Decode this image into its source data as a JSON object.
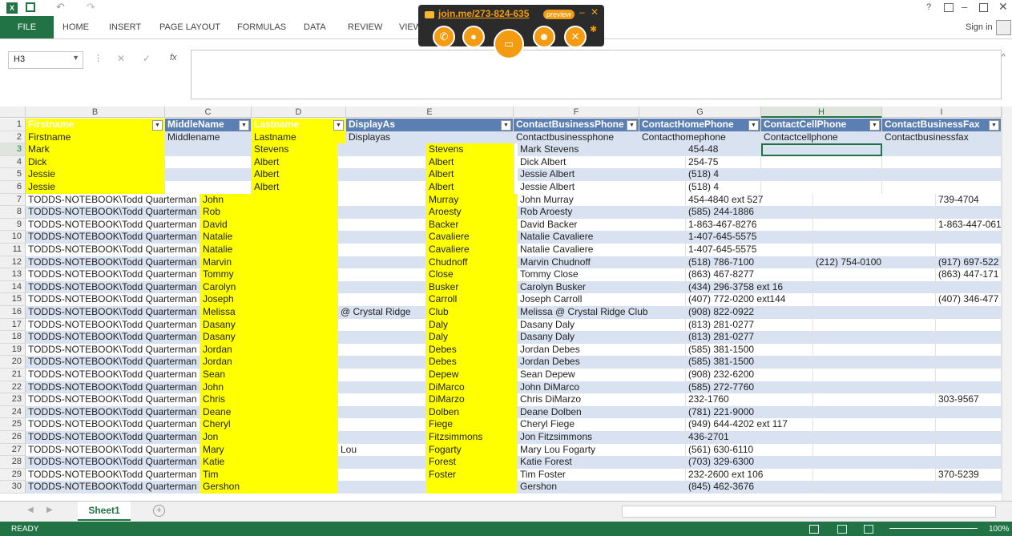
{
  "window": {
    "help": "?",
    "sign_in": "Sign in"
  },
  "ribbon": {
    "tabs": [
      "FILE",
      "HOME",
      "INSERT",
      "PAGE LAYOUT",
      "FORMULAS",
      "DATA",
      "REVIEW",
      "VIEW"
    ]
  },
  "formula_bar": {
    "name_box": "H3",
    "fx": "fx",
    "formula": ""
  },
  "joinme": {
    "url": "join.me/273-824-635",
    "badge": "preview"
  },
  "columns": [
    "B",
    "C",
    "D",
    "E",
    "F",
    "G",
    "H",
    "I"
  ],
  "header_row": [
    "Firstname",
    "MiddleName",
    "Lastname",
    "DisplayAs",
    "ContactBusinessPhone",
    "ContactHomePhone",
    "ContactCellPhone",
    "ContactBusinessFax"
  ],
  "row2": [
    "Firstname",
    "Middlename",
    "Lastname",
    "Displayas",
    "Contactbusinessphone",
    "Contacthomephone",
    "Contactcellphone",
    "Contactbusinessfax"
  ],
  "top_rows": [
    {
      "n": "3",
      "b": "Mark",
      "d": "Stevens",
      "e": "Stevens",
      "f": "Mark Stevens",
      "g": "454-48"
    },
    {
      "n": "4",
      "b": "Dick",
      "d": "Albert",
      "e": "Albert",
      "f": "Dick Albert",
      "g": "254-75"
    },
    {
      "n": "5",
      "b": "Jessie",
      "d": "Albert",
      "e": "Albert",
      "f": "Jessie Albert",
      "g": "(518) 4"
    },
    {
      "n": "6",
      "b": "Jessie",
      "d": "Albert",
      "e": "Albert",
      "f": "Jessie Albert",
      "g": "(518) 4"
    }
  ],
  "rows": [
    {
      "n": "7",
      "a": "TODDS-NOTEBOOK\\Todd Quarterman",
      "b": "John",
      "e": "Murray",
      "f": "John Murray",
      "g": "454-4840 ext 527",
      "h": "",
      "i": "739-4704"
    },
    {
      "n": "8",
      "a": "TODDS-NOTEBOOK\\Todd Quarterman",
      "b": "Rob",
      "e": "Aroesty",
      "f": "Rob Aroesty",
      "g": "(585) 244-1886",
      "h": "",
      "i": ""
    },
    {
      "n": "9",
      "a": "TODDS-NOTEBOOK\\Todd Quarterman",
      "b": "David",
      "e": "Backer",
      "f": "David Backer",
      "g": "1-863-467-8276",
      "h": "",
      "i": "1-863-447-061"
    },
    {
      "n": "10",
      "a": "TODDS-NOTEBOOK\\Todd Quarterman",
      "b": "Natalie",
      "e": "Cavaliere",
      "f": "Natalie Cavaliere",
      "g": "1-407-645-5575",
      "h": "",
      "i": ""
    },
    {
      "n": "11",
      "a": "TODDS-NOTEBOOK\\Todd Quarterman",
      "b": "Natalie",
      "e": "Cavaliere",
      "f": "Natalie Cavaliere",
      "g": "1-407-645-5575",
      "h": "",
      "i": ""
    },
    {
      "n": "12",
      "a": "TODDS-NOTEBOOK\\Todd Quarterman",
      "b": "Marvin",
      "e": "Chudnoff",
      "f": "Marvin Chudnoff",
      "g": "(518) 786-7100",
      "h": "(212) 754-0100",
      "i": "(917) 697-522"
    },
    {
      "n": "13",
      "a": "TODDS-NOTEBOOK\\Todd Quarterman",
      "b": "Tommy",
      "e": "Close",
      "f": "Tommy Close",
      "g": "(863) 467-8277",
      "h": "",
      "i": "(863) 447-171"
    },
    {
      "n": "14",
      "a": "TODDS-NOTEBOOK\\Todd Quarterman",
      "b": "Carolyn",
      "e": "Busker",
      "f": "Carolyn Busker",
      "g": "(434) 296-3758 ext 16",
      "h": "",
      "i": ""
    },
    {
      "n": "15",
      "a": "TODDS-NOTEBOOK\\Todd Quarterman",
      "b": "Joseph",
      "e": "Carroll",
      "f": "Joseph Carroll",
      "g": "(407) 772-0200 ext144",
      "h": "",
      "i": "(407) 346-477"
    },
    {
      "n": "16",
      "a": "TODDS-NOTEBOOK\\Todd Quarterman",
      "b": "Melissa",
      "d2": "@ Crystal Ridge",
      "e": "Club",
      "f": "Melissa @ Crystal Ridge Club",
      "g": "(908) 822-0922",
      "h": "",
      "i": ""
    },
    {
      "n": "17",
      "a": "TODDS-NOTEBOOK\\Todd Quarterman",
      "b": "Dasany",
      "e": "Daly",
      "f": "Dasany Daly",
      "g": "(813) 281-0277",
      "h": "",
      "i": ""
    },
    {
      "n": "18",
      "a": "TODDS-NOTEBOOK\\Todd Quarterman",
      "b": "Dasany",
      "e": "Daly",
      "f": "Dasany Daly",
      "g": "(813) 281-0277",
      "h": "",
      "i": ""
    },
    {
      "n": "19",
      "a": "TODDS-NOTEBOOK\\Todd Quarterman",
      "b": "Jordan",
      "e": "Debes",
      "f": "Jordan Debes",
      "g": "(585) 381-1500",
      "h": "",
      "i": ""
    },
    {
      "n": "20",
      "a": "TODDS-NOTEBOOK\\Todd Quarterman",
      "b": "Jordan",
      "e": "Debes",
      "f": "Jordan Debes",
      "g": "(585) 381-1500",
      "h": "",
      "i": ""
    },
    {
      "n": "21",
      "a": "TODDS-NOTEBOOK\\Todd Quarterman",
      "b": "Sean",
      "e": "Depew",
      "f": "Sean Depew",
      "g": "(908) 232-6200",
      "h": "",
      "i": ""
    },
    {
      "n": "22",
      "a": "TODDS-NOTEBOOK\\Todd Quarterman",
      "b": "John",
      "e": "DiMarco",
      "f": "John DiMarco",
      "g": "(585) 272-7760",
      "h": "",
      "i": ""
    },
    {
      "n": "23",
      "a": "TODDS-NOTEBOOK\\Todd Quarterman",
      "b": "Chris",
      "e": "DiMarzo",
      "f": "Chris DiMarzo",
      "g": "232-1760",
      "h": "",
      "i": "303-9567"
    },
    {
      "n": "24",
      "a": "TODDS-NOTEBOOK\\Todd Quarterman",
      "b": "Deane",
      "e": "Dolben",
      "f": "Deane Dolben",
      "g": "(781) 221-9000",
      "h": "",
      "i": ""
    },
    {
      "n": "25",
      "a": "TODDS-NOTEBOOK\\Todd Quarterman",
      "b": "Cheryl",
      "e": "Fiege",
      "f": "Cheryl Fiege",
      "g": "(949) 644-4202 ext 117",
      "h": "",
      "i": ""
    },
    {
      "n": "26",
      "a": "TODDS-NOTEBOOK\\Todd Quarterman",
      "b": "Jon",
      "e": "Fitzsimmons",
      "f": "Jon Fitzsimmons",
      "g": "436-2701",
      "h": "",
      "i": ""
    },
    {
      "n": "27",
      "a": "TODDS-NOTEBOOK\\Todd Quarterman",
      "b": "Mary",
      "d2": "Lou",
      "e": "Fogarty",
      "f": "Mary Lou Fogarty",
      "g": "(561) 630-6110",
      "h": "",
      "i": ""
    },
    {
      "n": "28",
      "a": "TODDS-NOTEBOOK\\Todd Quarterman",
      "b": "Katie",
      "e": "Forest",
      "f": "Katie Forest",
      "g": "(703) 329-6300",
      "h": "",
      "i": ""
    },
    {
      "n": "29",
      "a": "TODDS-NOTEBOOK\\Todd Quarterman",
      "b": "Tim",
      "e": "Foster",
      "f": "Tim Foster",
      "g": "232-2600 ext 106",
      "h": "",
      "i": "370-5239"
    },
    {
      "n": "30",
      "a": "TODDS-NOTEBOOK\\Todd Quarterman",
      "b": "Gershon",
      "e": "",
      "f": "Gershon",
      "g": "(845) 462-3676",
      "h": "",
      "i": ""
    }
  ],
  "sheet_tab": "Sheet1",
  "status": {
    "ready": "READY",
    "zoom": "100%"
  }
}
